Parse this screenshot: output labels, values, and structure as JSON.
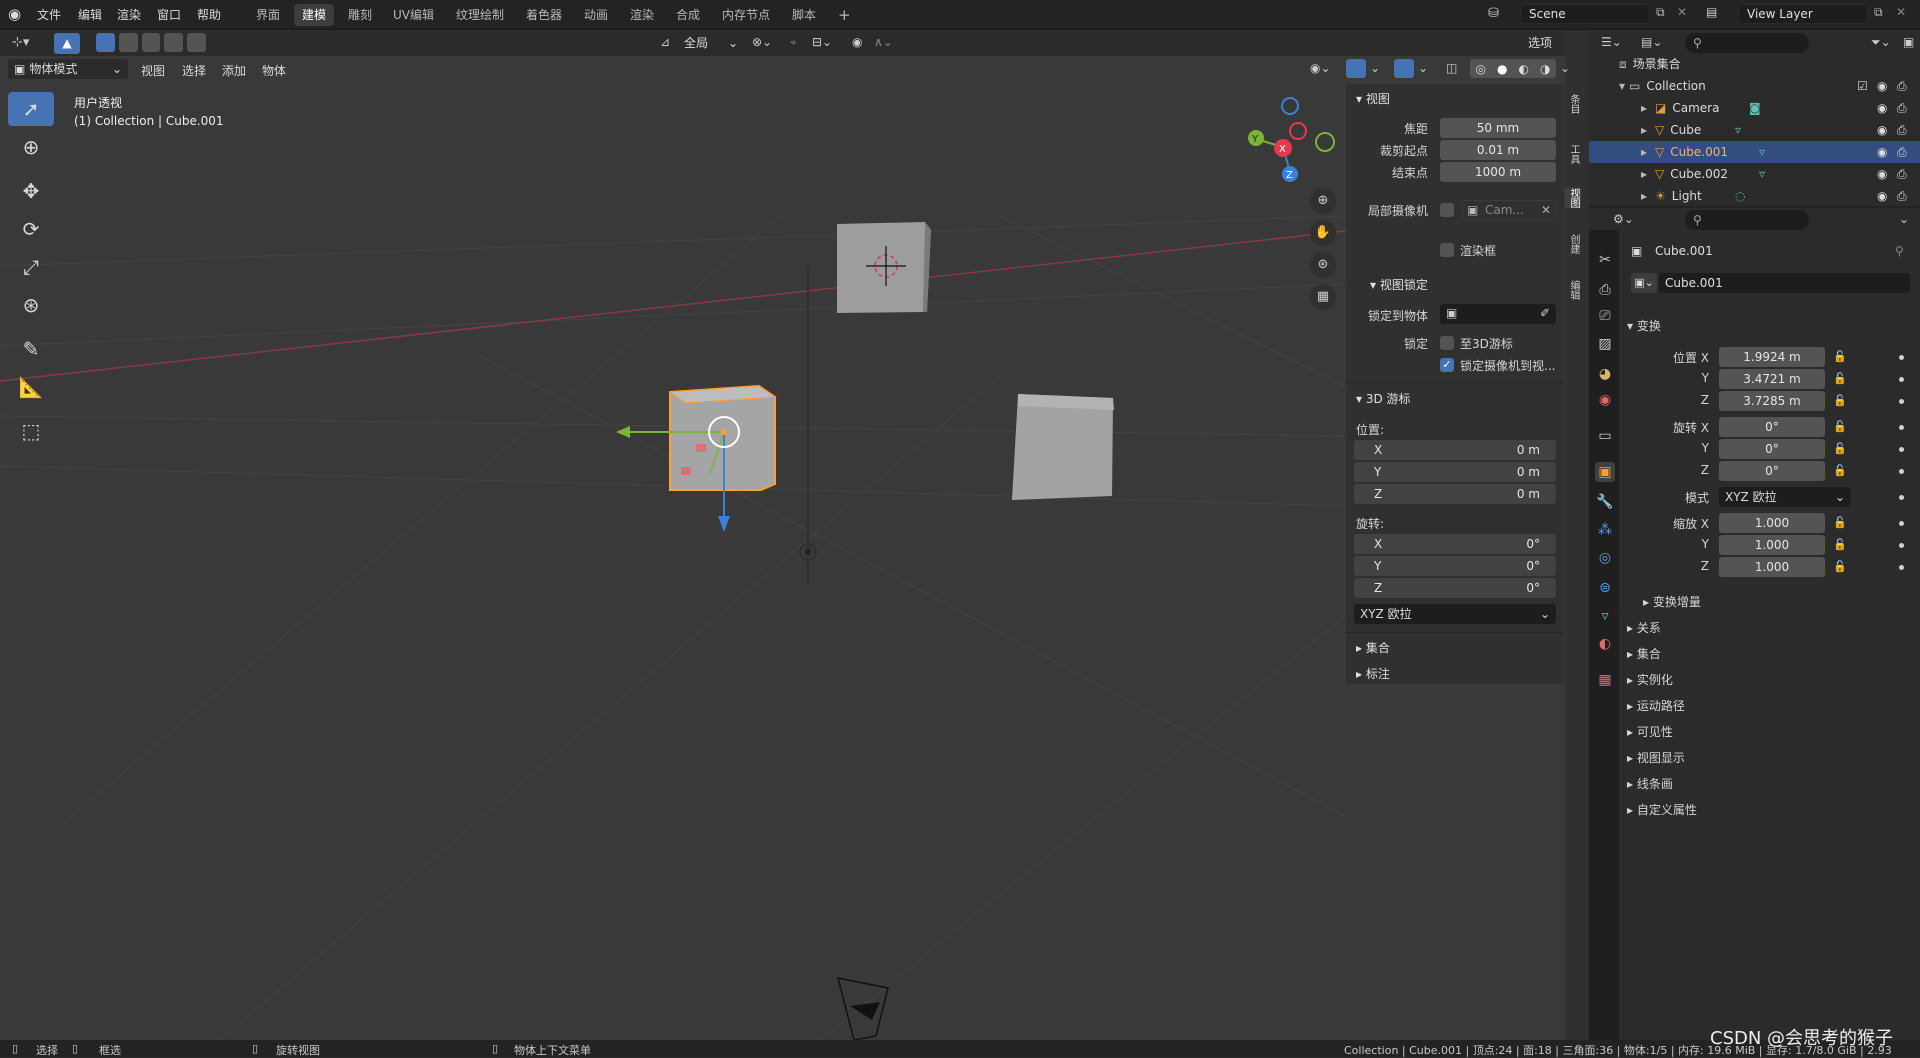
{
  "topbar": {
    "menus": [
      "文件",
      "编辑",
      "渲染",
      "窗口",
      "帮助"
    ],
    "workspaces": [
      "界面",
      "建模",
      "雕刻",
      "UV编辑",
      "纹理绘制",
      "着色器",
      "动画",
      "渲染",
      "合成",
      "内存节点",
      "脚本"
    ],
    "active_workspace": "建模",
    "add_workspace": "+",
    "scene_name": "Scene",
    "view_layer": "View Layer"
  },
  "vp_header": {
    "mode": "物体模式",
    "menus": [
      "视图",
      "选择",
      "添加",
      "物体"
    ],
    "transform_orientation": "全局",
    "options_label": "选项"
  },
  "viewport": {
    "view_name": "用户透视",
    "collection_info": "(1) Collection | Cube.001"
  },
  "npanel": {
    "view_section": "视图",
    "focal_label": "焦距",
    "focal_value": "50 mm",
    "clip_start_label": "裁剪起点",
    "clip_start_value": "0.01 m",
    "clip_end_label": "结束点",
    "clip_end_value": "1000 m",
    "local_camera_label": "局部摄像机",
    "local_camera_value": "Cam...",
    "render_region_label": "渲染框",
    "view_lock_section": "视图锁定",
    "lock_to_object_label": "锁定到物体",
    "lock_label": "锁定",
    "lock_cursor_label": "至3D游标",
    "lock_camera_label": "锁定摄像机到视...",
    "cursor_section": "3D 游标",
    "location_label": "位置:",
    "rotation_label": "旋转:",
    "cursor_loc": [
      {
        "axis": "X",
        "value": "0 m"
      },
      {
        "axis": "Y",
        "value": "0 m"
      },
      {
        "axis": "Z",
        "value": "0 m"
      }
    ],
    "cursor_rot": [
      {
        "axis": "X",
        "value": "0°"
      },
      {
        "axis": "Y",
        "value": "0°"
      },
      {
        "axis": "Z",
        "value": "0°"
      }
    ],
    "rotation_mode": "XYZ 欧拉",
    "collection_section": "集合",
    "annotation_section": "标注"
  },
  "sidetabs": [
    "条目",
    "工具",
    "视图",
    "创建",
    "编辑"
  ],
  "outliner": {
    "root": "场景集合",
    "collection": "Collection",
    "items": [
      {
        "name": "Camera",
        "icon": "camera-icon",
        "color": "#e39d3f"
      },
      {
        "name": "Cube",
        "icon": "mesh-icon",
        "color": "#e39d3f"
      },
      {
        "name": "Cube.001",
        "icon": "mesh-icon",
        "color": "#e39d3f"
      },
      {
        "name": "Cube.002",
        "icon": "mesh-icon",
        "color": "#e39d3f"
      },
      {
        "name": "Light",
        "icon": "light-icon",
        "color": "#e39d3f"
      }
    ],
    "selected": "Cube.001"
  },
  "properties": {
    "object_name": "Cube.001",
    "object_field": "Cube.001",
    "transform_section": "变换",
    "location_label": "位置 X",
    "rotation_label": "旋转 X",
    "scale_label": "缩放 X",
    "mode_label": "模式",
    "mode_value": "XYZ 欧拉",
    "y_label": "Y",
    "z_label": "Z",
    "location": [
      "1.9924 m",
      "3.4721 m",
      "3.7285 m"
    ],
    "rotation": [
      "0°",
      "0°",
      "0°"
    ],
    "scale": [
      "1.000",
      "1.000",
      "1.000"
    ],
    "delta_transform": "变换增量",
    "sections": [
      "关系",
      "集合",
      "实例化",
      "运动路径",
      "可见性",
      "视图显示",
      "线条画",
      "自定义属性"
    ]
  },
  "statusbar": {
    "select": "选择",
    "box_select": "框选",
    "rotate_view": "旋转视图",
    "context_menu": "物体上下文菜单",
    "stats": "Collection | Cube.001 | 顶点:24 | 面:18 | 三角面:36 | 物体:1/5 | 内存: 19.6 MiB | 显存: 1.7/8.0 GiB | 2.93",
    "watermark": "CSDN @会思考的猴子"
  },
  "colors": {
    "accent": "#4772b3",
    "selection": "#ffa030",
    "x_axis": "#e23c4b",
    "y_axis": "#7ab535",
    "z_axis": "#3a81d9"
  }
}
